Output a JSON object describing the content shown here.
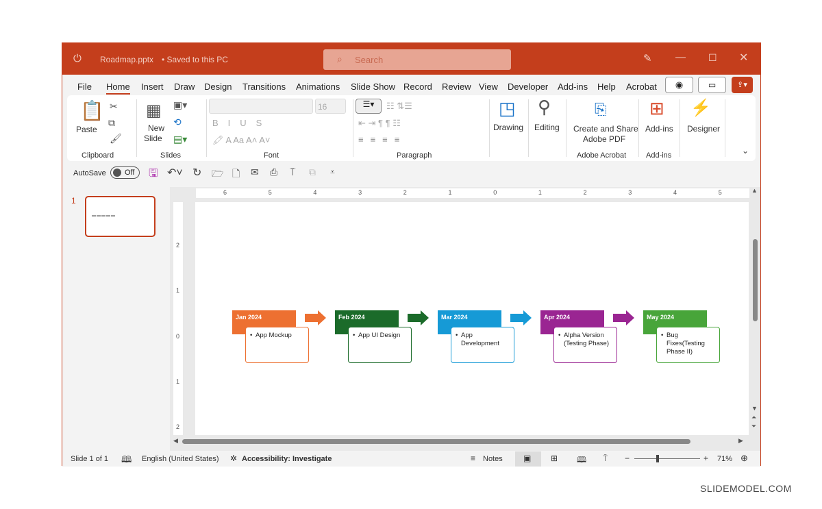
{
  "titlebar": {
    "file": "Roadmap.pptx",
    "save_status": "• Saved to this PC",
    "search_placeholder": "Search"
  },
  "tabs": [
    "File",
    "Home",
    "Insert",
    "Draw",
    "Design",
    "Transitions",
    "Animations",
    "Slide Show",
    "Record",
    "Review",
    "View",
    "Developer",
    "Add-ins",
    "Help",
    "Acrobat"
  ],
  "active_tab": "Home",
  "ribbon": {
    "paste": "Paste",
    "new_slide_1": "New",
    "new_slide_2": "Slide",
    "font_size": "16",
    "drawing": "Drawing",
    "editing": "Editing",
    "acrobat_1": "Create and Share",
    "acrobat_2": "Adobe PDF",
    "addins": "Add-ins",
    "designer": "Designer",
    "groups": {
      "clipboard": "Clipboard",
      "slides": "Slides",
      "font": "Font",
      "paragraph": "Paragraph",
      "adobe": "Adobe Acrobat",
      "addins": "Add-ins"
    }
  },
  "qat": {
    "autosave": "AutoSave",
    "toggle": "Off"
  },
  "thumb": {
    "number": "1"
  },
  "ruler_h": [
    "6",
    "5",
    "4",
    "3",
    "2",
    "1",
    "0",
    "1",
    "2",
    "3",
    "4",
    "5"
  ],
  "ruler_v": [
    "2",
    "1",
    "0",
    "1",
    "2"
  ],
  "timeline": [
    {
      "month": "Jan 2024",
      "task": "App Mockup",
      "color": "#ed7031"
    },
    {
      "month": "Feb 2024",
      "task": "App UI Design",
      "color": "#1b6b2a"
    },
    {
      "month": "Mar 2024",
      "task": "App Development",
      "color": "#169ad6"
    },
    {
      "month": "Apr 2024",
      "task": "Alpha Version (Testing Phase)",
      "color": "#9a2592"
    },
    {
      "month": "May 2024",
      "task": "Bug Fixes(Testing Phase II)",
      "color": "#48a53a"
    }
  ],
  "status": {
    "slide": "Slide 1 of 1",
    "language": "English (United States)",
    "accessibility": "Accessibility: Investigate",
    "notes": "Notes",
    "zoom": "71%"
  },
  "watermark": "SLIDEMODEL.COM"
}
